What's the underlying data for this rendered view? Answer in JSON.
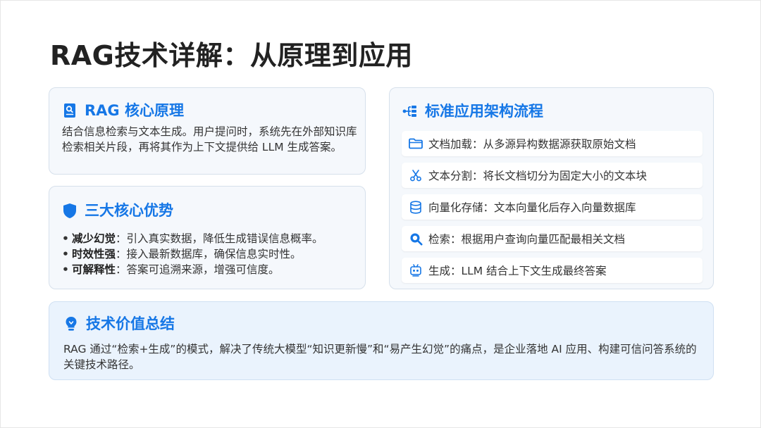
{
  "page": {
    "title": "RAG技术详解：从原理到应用"
  },
  "colors": {
    "accent": "#1677e6",
    "card_bg": "#f5f8fc",
    "summary_bg": "#eaf3fd"
  },
  "principle": {
    "icon": "document-search-icon",
    "title": "RAG 核心原理",
    "text": "结合信息检索与文本生成。用户提问时，系统先在外部知识库检索相关片段，再将其作为上下文提供给 LLM 生成答案。"
  },
  "advantages": {
    "icon": "shield-icon",
    "title": "三大核心优势",
    "items": [
      {
        "term": "减少幻觉",
        "text": "：引入真实数据，降低生成错误信息概率。"
      },
      {
        "term": "时效性强",
        "text": "：接入最新数据库，确保信息实时性。"
      },
      {
        "term": "可解释性",
        "text": "：答案可追溯来源，增强可信度。"
      }
    ]
  },
  "flow": {
    "icon": "hierarchy-icon",
    "title": "标准应用架构流程",
    "steps": [
      {
        "icon": "folder-icon",
        "label": "文档加载：从多源异构数据源获取原始文档"
      },
      {
        "icon": "scissors-icon",
        "label": "文本分割：将长文档切分为固定大小的文本块"
      },
      {
        "icon": "database-icon",
        "label": "向量化存储：文本向量化后存入向量数据库"
      },
      {
        "icon": "search-icon",
        "label": "检索：根据用户查询向量匹配最相关文档"
      },
      {
        "icon": "robot-icon",
        "label": "生成：LLM 结合上下文生成最终答案"
      }
    ]
  },
  "summary": {
    "icon": "lightbulb-icon",
    "title": "技术价值总结",
    "text": "RAG 通过“检索+生成”的模式，解决了传统大模型“知识更新慢”和“易产生幻觉”的痛点，是企业落地 AI 应用、构建可信问答系统的关键技术路径。"
  }
}
